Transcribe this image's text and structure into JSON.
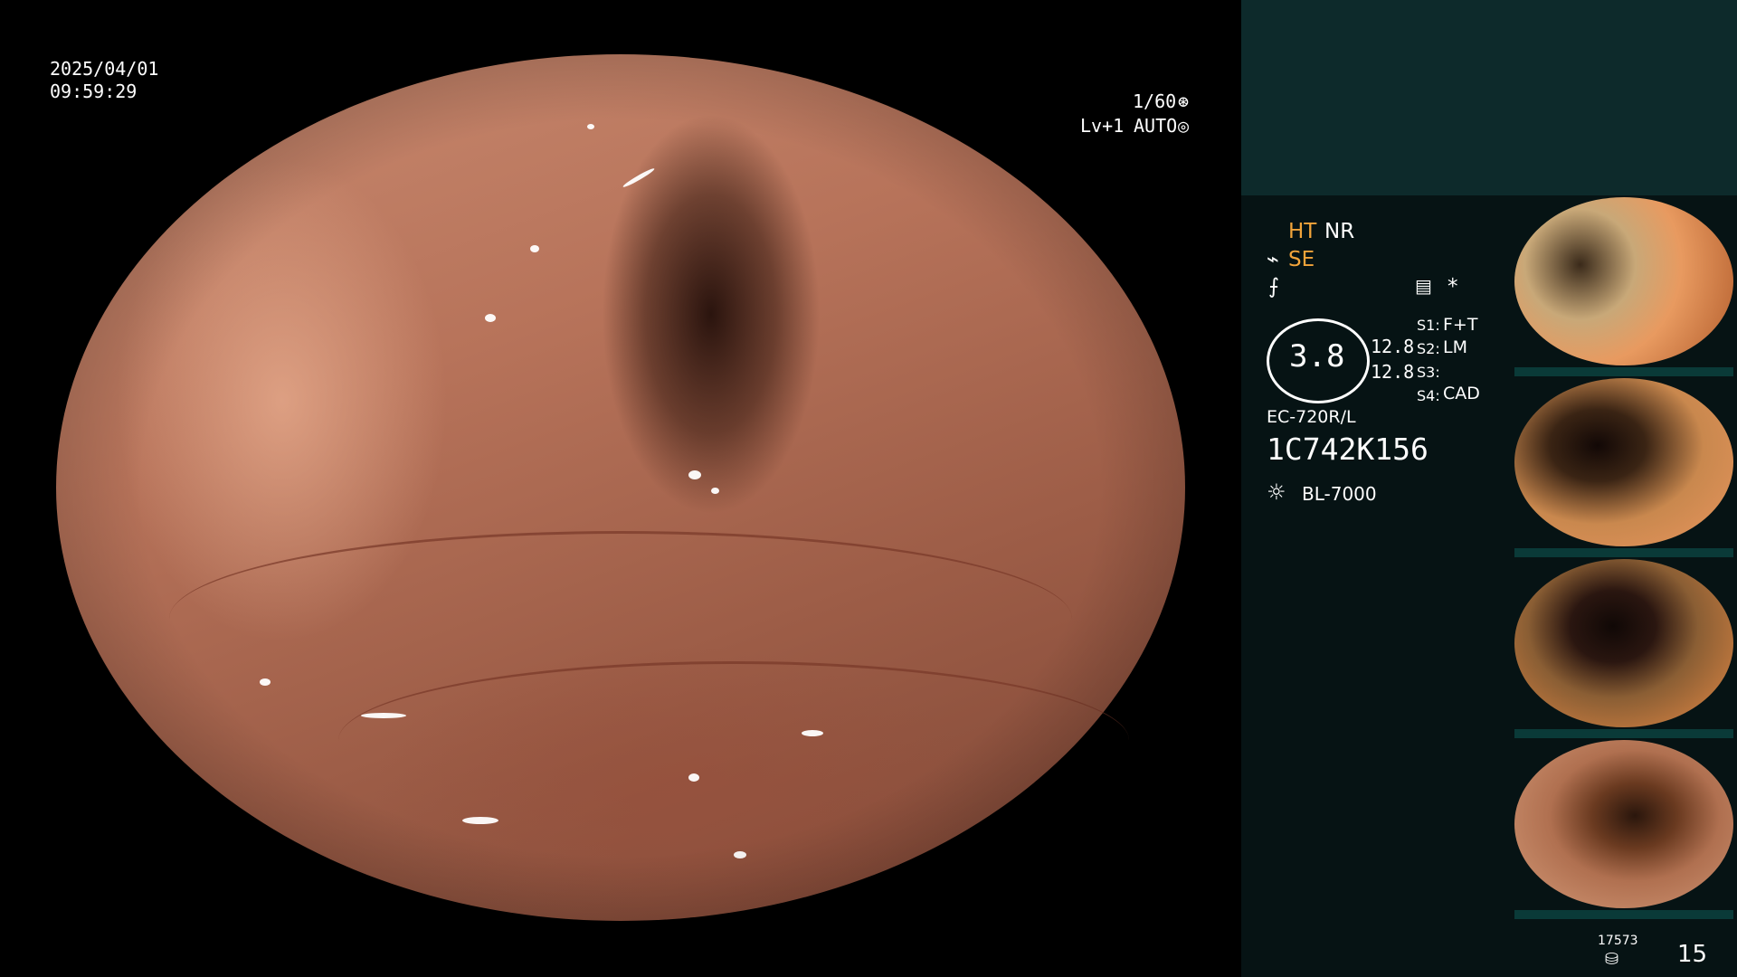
{
  "osd": {
    "date": "2025/04/01",
    "time": "09:59:29",
    "shutter": "1/60",
    "shutter_icon": "aperture-icon",
    "level": "Lv+1",
    "mode": "AUTO",
    "mode_icon": "iris-icon"
  },
  "info": {
    "ht": "HT",
    "nr": "NR",
    "se": "SE",
    "se_icon": "se-icon",
    "freeze_icon": "freeze-icon",
    "memo_icon": "memo-icon",
    "asterisk": "*",
    "gauge_value": "3.8",
    "val1": "12.8",
    "val2": "12.8",
    "s1_label": "S1:",
    "s1_value": "F+T",
    "s2_label": "S2:",
    "s2_value": "LM",
    "s3_label": "S3:",
    "s3_value": "",
    "s4_label": "S4:",
    "s4_value": "CAD",
    "scope_model": "EC-720R/L",
    "scope_serial": "1C742K156",
    "light_icon": "light-source-icon",
    "light_source": "BL-7000"
  },
  "footer": {
    "counter": "17573",
    "disk_icon": "storage-icon",
    "page": "15"
  },
  "colors": {
    "amber": "#f2a43a",
    "panel": "#061314",
    "panel_top": "#0d2a2b"
  }
}
